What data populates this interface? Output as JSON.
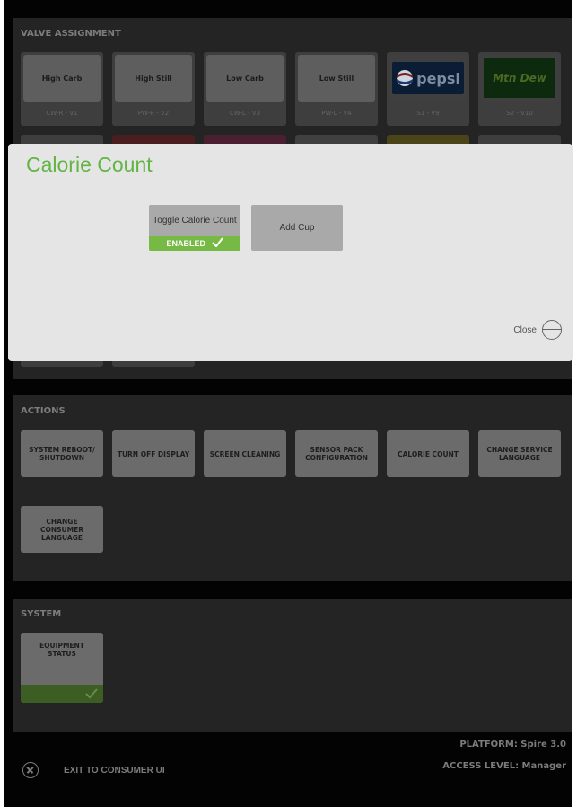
{
  "valve_section": {
    "title": "VALVE ASSIGNMENT",
    "tiles": [
      {
        "name": "High Carb",
        "code": "CW-R - V1"
      },
      {
        "name": "High Still",
        "code": "PW-R - V2"
      },
      {
        "name": "Low Carb",
        "code": "CW-L - V3"
      },
      {
        "name": "Low Still",
        "code": "PW-L - V4"
      },
      {
        "name": "",
        "code": "S1 - V9",
        "logo": "pepsi",
        "logo_text": "pepsi"
      },
      {
        "name": "",
        "code": "S2 - V10",
        "logo": "mountain-dew",
        "logo_text": "Mtn Dew"
      }
    ]
  },
  "modal": {
    "title": "Calorie Count",
    "toggle_label": "Toggle Calorie Count",
    "toggle_state": "ENABLED",
    "add_cup_label": "Add Cup",
    "close_label": "Close"
  },
  "actions": {
    "title": "ACTIONS",
    "buttons": [
      "SYSTEM REBOOT/ SHUTDOWN",
      "TURN OFF DISPLAY",
      "SCREEN CLEANING",
      "SENSOR PACK CONFIGURATION",
      "CALORIE COUNT",
      "CHANGE SERVICE LANGUAGE",
      "CHANGE CONSUMER LANGUAGE"
    ]
  },
  "system": {
    "title": "SYSTEM",
    "equipment_status": "EQUIPMENT STATUS"
  },
  "footer": {
    "exit": "EXIT TO CONSUMER UI",
    "platform": "PLATFORM: Spire 3.0",
    "access_level": "ACCESS LEVEL: Manager"
  },
  "colors": {
    "accent_green": "#62b445",
    "enabled_green": "#76b944",
    "modal_bg": "#e5e5e5"
  }
}
